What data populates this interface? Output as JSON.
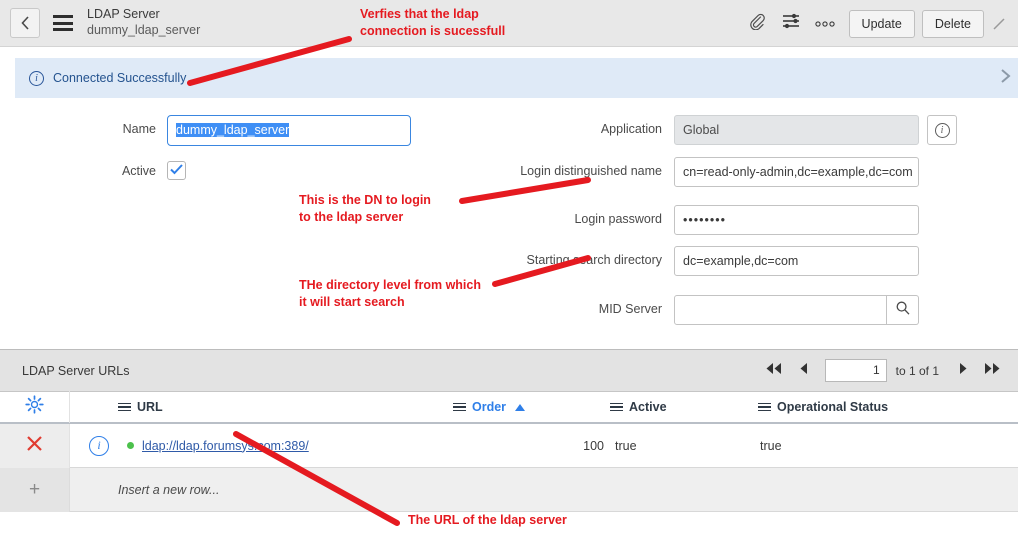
{
  "header": {
    "back_icon": "chevron-left-icon",
    "menu_icon": "hamburger-menu-icon",
    "title": "LDAP Server",
    "subtitle": "dummy_ldap_server",
    "attachment_icon": "paperclip-icon",
    "filter_icon": "sliders-icon",
    "more_icon": "more-options-icon",
    "update_label": "Update",
    "delete_label": "Delete"
  },
  "banner": {
    "icon": "info-circle-icon",
    "text": "Connected Successfully",
    "close_icon": "chevron-right-icon"
  },
  "form": {
    "name_label": "Name",
    "name_value": "dummy_ldap_server",
    "active_label": "Active",
    "active_checked": true,
    "application_label": "Application",
    "application_value": "Global",
    "application_info_icon": "info-circle-icon",
    "login_dn_label": "Login distinguished name",
    "login_dn_value": "cn=read-only-admin,dc=example,dc=com",
    "login_password_label": "Login password",
    "login_password_value": "••••••••",
    "starting_dir_label": "Starting search directory",
    "starting_dir_value": "dc=example,dc=com",
    "mid_server_label": "MID Server",
    "mid_server_value": "",
    "mid_server_lookup_icon": "magnifier-icon"
  },
  "list": {
    "title": "LDAP Server URLs",
    "gear_icon": "gear-icon",
    "pager": {
      "first_icon": "double-left-icon",
      "prev_icon": "left-icon",
      "page_value": "1",
      "range_text": "to 1 of 1",
      "next_icon": "right-icon",
      "last_icon": "double-right-icon"
    },
    "columns": [
      {
        "label": "URL",
        "sorted": false
      },
      {
        "label": "Order",
        "sorted": true,
        "sort_dir": "asc"
      },
      {
        "label": "Active",
        "sorted": false
      },
      {
        "label": "Operational Status",
        "sorted": false
      }
    ],
    "rows": [
      {
        "delete_icon": "close-x-icon",
        "info_icon": "info-circle-icon",
        "status_dot": "green",
        "url": "ldap://ldap.forumsys.com:389/",
        "order": "100",
        "active": "true",
        "operational_status": "true"
      }
    ],
    "new_row": {
      "plus_icon": "plus-icon",
      "text": "Insert a new row..."
    }
  },
  "annotations": [
    {
      "text": "Verfies that the ldap\nconnection is sucessfull"
    },
    {
      "text": "This is the DN to login\nto the ldap server"
    },
    {
      "text": "THe directory level from which\nit will start search"
    },
    {
      "text": "The URL of the ldap server"
    }
  ],
  "colors": {
    "accent_blue": "#2f7fe8",
    "annotation_red": "#e51a20",
    "banner_bg": "#dfeaf7",
    "status_green": "#4cc14c"
  }
}
